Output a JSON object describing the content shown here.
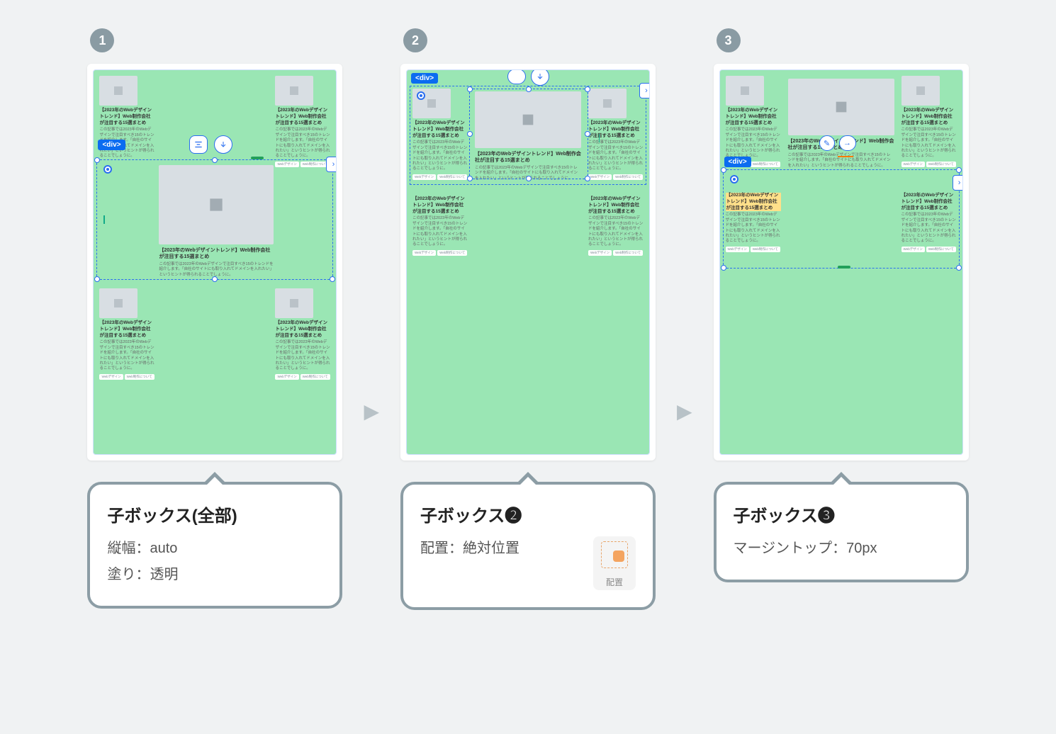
{
  "steps": [
    {
      "n": "1",
      "caption_title": "子ボックス(全部)",
      "lines": [
        "縦幅：auto",
        "塗り：透明"
      ]
    },
    {
      "n": "2",
      "caption_title": "子ボックス❷",
      "lines": [
        "配置：絶対位置"
      ],
      "icon_label": "配置"
    },
    {
      "n": "3",
      "caption_title": "子ボックス❸",
      "lines": [
        "マージントップ：70px"
      ]
    }
  ],
  "selection_tag": "<div>",
  "card": {
    "title": "【2023年のWebデザイントレンド】Web制作会社が注目する15選まとめ",
    "body": "この記事では2023年のWebデザインで注目すべき15のトレンドを紹介します。「自社のサイトにも取り入れてドメインを入れたい」というヒントが得られることでしょうに。",
    "tags": [
      "Webデザイン",
      "Web制作について"
    ]
  },
  "center": {
    "title": "【2023年のWebデザイントレンド】Web制作会社が注目する15選まとめ",
    "body": "この記事では2023年のWebデザインで注目すべき15のトレンドを紹介します。「自社のサイトにも取り入れてドメインを入れたい」というヒントが得られることでしょうに。"
  }
}
